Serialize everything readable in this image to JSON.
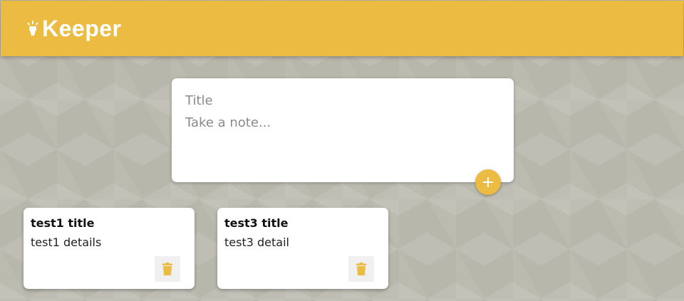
{
  "header": {
    "app_name": "Keeper",
    "icon": "lightbulb-icon"
  },
  "create_note": {
    "title_placeholder": "Title",
    "content_placeholder": "Take a note...",
    "add_icon": "plus-icon"
  },
  "notes": [
    {
      "title": "test1 title",
      "content": "test1 details",
      "delete_icon": "trash-icon"
    },
    {
      "title": "test3 title",
      "content": "test3 detail",
      "delete_icon": "trash-icon"
    }
  ],
  "colors": {
    "accent": "#ebbb42",
    "background": "#b8b7ab",
    "card": "#ffffff"
  }
}
